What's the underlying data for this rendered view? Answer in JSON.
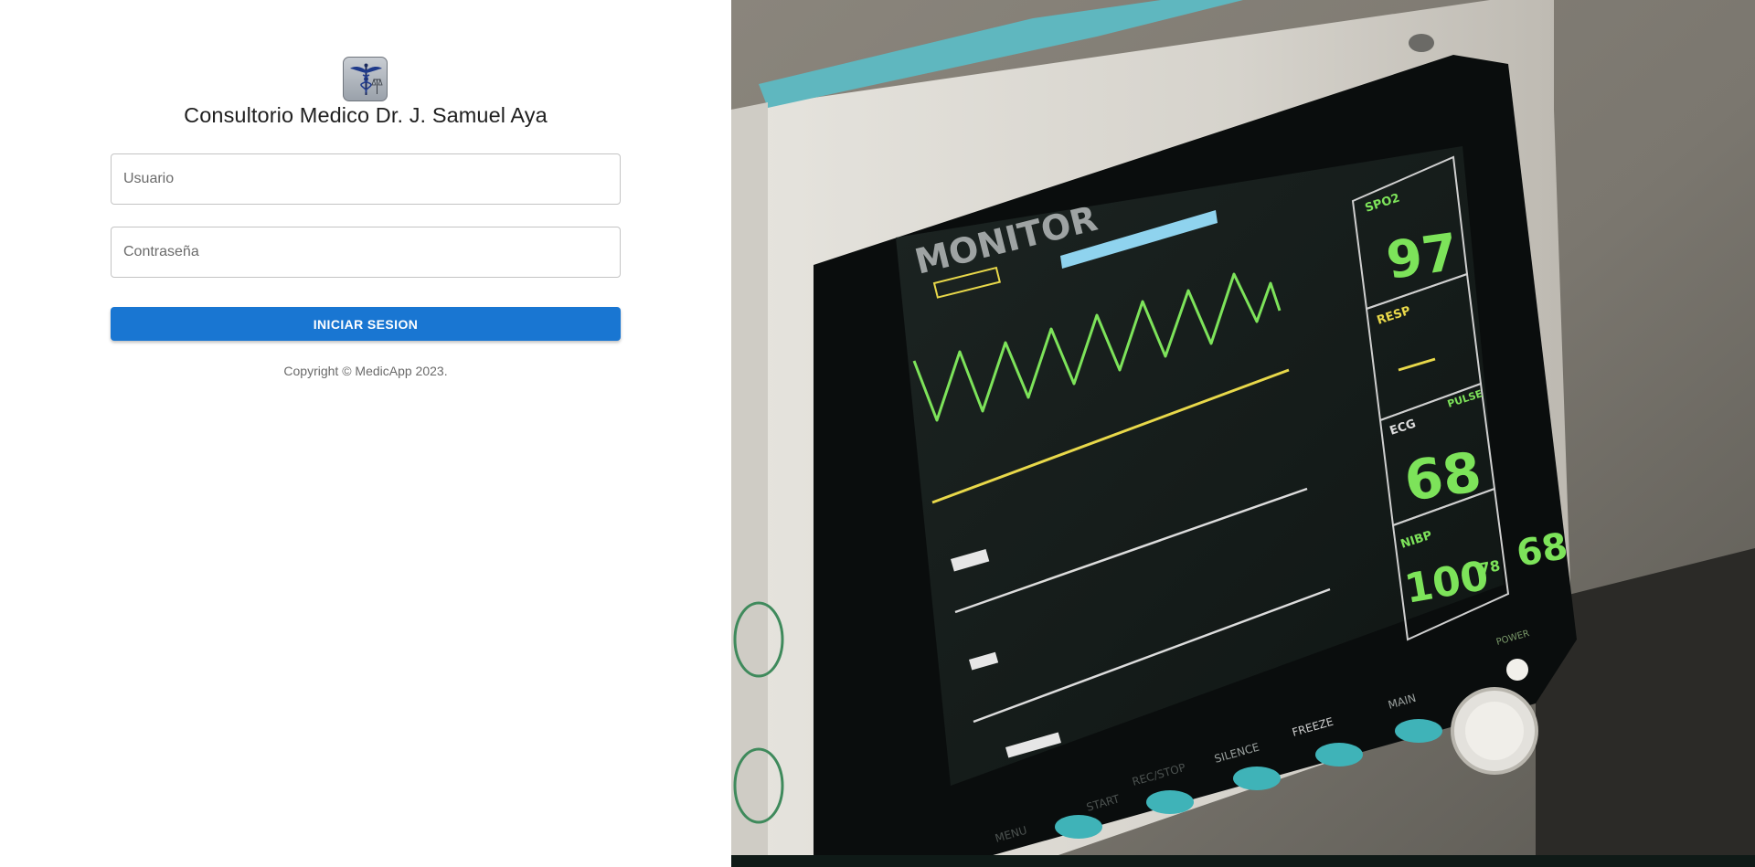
{
  "login": {
    "logo_icon": "caduceus-icon",
    "title": "Consultorio Medico Dr. J. Samuel Aya",
    "username_placeholder": "Usuario",
    "password_placeholder": "Contraseña",
    "submit_label": "INICIAR SESION",
    "copyright": "Copyright © MedicApp 2023."
  },
  "hero_image": {
    "description_icon": "patient-monitor-image",
    "monitor": {
      "brand": "MONITOR",
      "spo2_label": "SPO2",
      "spo2_value": "97",
      "resp_label": "RESP",
      "ecg_label": "ECG",
      "pulse_label": "PULSE",
      "heart_rate": "68",
      "nibp_label": "NIBP",
      "nibp_systolic": "100",
      "nibp_map": "78",
      "nibp_diastolic": "68",
      "buttons": [
        "MENU",
        "START",
        "REC/STOP",
        "SILENCE",
        "FREEZE",
        "MAIN"
      ],
      "power_label": "POWER"
    }
  },
  "colors": {
    "primary": "#1976d2",
    "monitor_green": "#7de35a",
    "monitor_yellow": "#e8d84a",
    "monitor_teal": "#3fb3b8"
  }
}
